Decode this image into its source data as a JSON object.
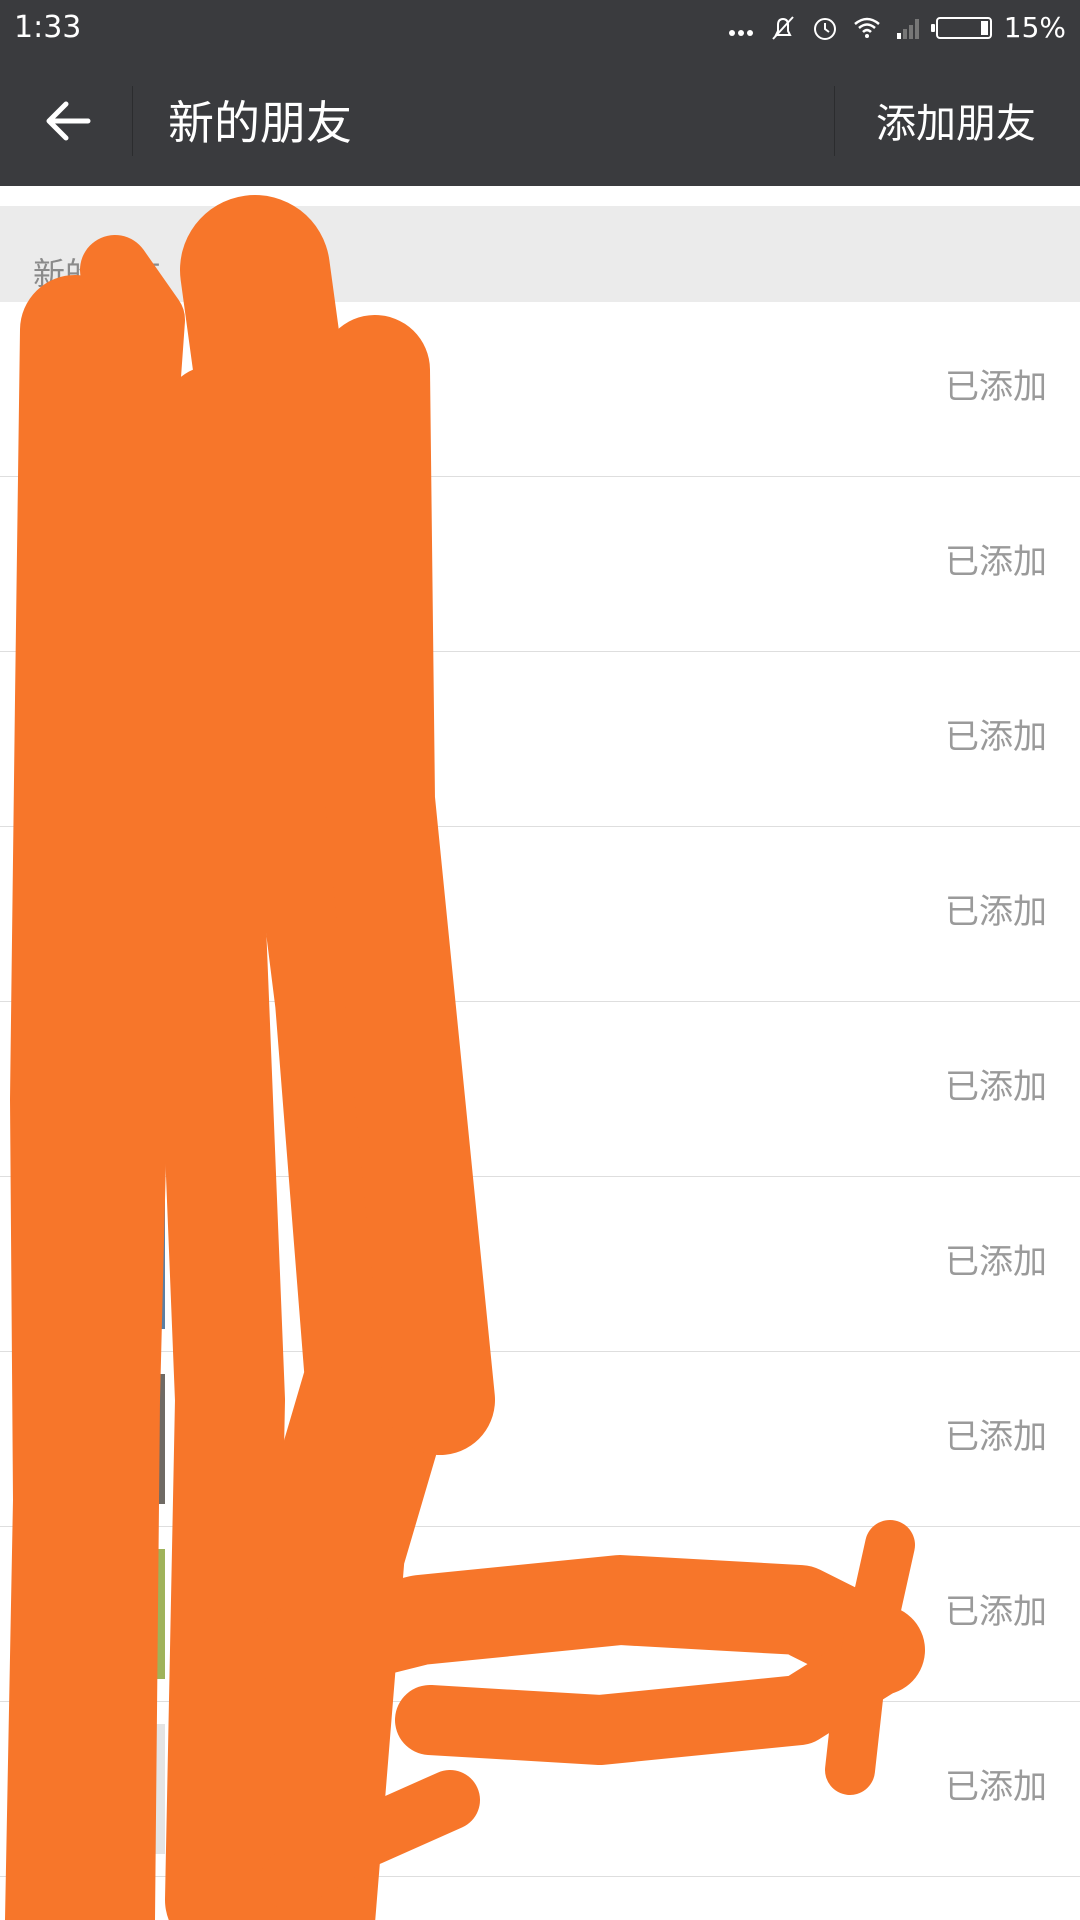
{
  "status_bar": {
    "time": "1:33",
    "battery_text": "15%",
    "battery_level": 0.15,
    "icons": [
      "more-dots-icon",
      "mute-bell-icon",
      "alarm-icon",
      "wifi-icon",
      "signal-icon",
      "battery-icon"
    ]
  },
  "title_bar": {
    "back_icon": "back-arrow-icon",
    "title": "新的朋友",
    "action_label": "添加朋友"
  },
  "section": {
    "label": "新的朋友"
  },
  "friends": [
    {
      "status": "已添加",
      "avatar_color": "#b65a2e"
    },
    {
      "status": "已添加",
      "avatar_color": "#7b6a4f"
    },
    {
      "status": "已添加",
      "avatar_color": "#d8c8a0"
    },
    {
      "status": "已添加",
      "avatar_color": "#e6e6e6"
    },
    {
      "status": "已添加",
      "avatar_color": "#56626f"
    },
    {
      "status": "已添加",
      "avatar_color": "#5b7fa3"
    },
    {
      "status": "已添加",
      "avatar_color": "#6f6a64"
    },
    {
      "status": "已添加",
      "avatar_color": "#9fb35a"
    },
    {
      "status": "已添加",
      "avatar_color": "#e4e4e4"
    }
  ],
  "colors": {
    "header_bg": "#3a3b3e",
    "section_bg": "#ebebeb",
    "status_text": "#9a9a9a",
    "scribble": "#f7762a"
  }
}
